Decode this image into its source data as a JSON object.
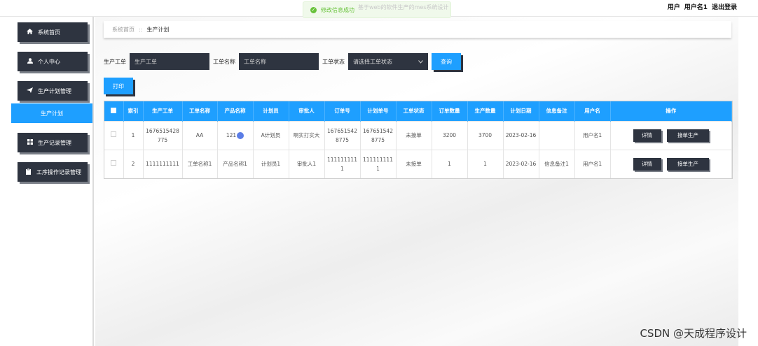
{
  "header": {
    "user_role": "用户",
    "username": "用户名1",
    "logout": "退出登录"
  },
  "toast": {
    "message": "修改信息成功",
    "ghost_title": "基于web的软件生产的mes系统设计"
  },
  "sidebar": {
    "items": [
      {
        "label": "系统首页",
        "icon": "home-icon"
      },
      {
        "label": "个人中心",
        "icon": "user-icon"
      },
      {
        "label": "生产计划管理",
        "icon": "send-icon"
      },
      {
        "label": "生产记录管理",
        "icon": "grid-icon"
      },
      {
        "label": "工序操作记录管理",
        "icon": "clipboard-icon"
      }
    ],
    "active_sub": "生产计划"
  },
  "breadcrumb": {
    "home": "系统首页",
    "separator": "::",
    "current": "生产计划"
  },
  "search": {
    "field1_label": "生产工单",
    "field1_placeholder": "生产工单",
    "field2_label": "工单名称",
    "field2_placeholder": "工单名称",
    "field3_label": "工单状态",
    "field3_placeholder": "请选择工单状态",
    "query_button": "查询"
  },
  "toolbar": {
    "print_button": "打印"
  },
  "table": {
    "headers": [
      "",
      "索引",
      "生产工单",
      "工单名称",
      "产品名称",
      "计划员",
      "审批人",
      "订单号",
      "计划单号",
      "工单状态",
      "订单数量",
      "生产数量",
      "计划日期",
      "信息备注",
      "用户名",
      "操作"
    ],
    "rows": [
      {
        "index": "1",
        "order": "1676515428775",
        "name": "AA",
        "product": "121",
        "planner": "A计划员",
        "approver": "啊实打实大",
        "order_no": "1676515428775",
        "plan_no": "1676515428775",
        "status": "未接单",
        "order_qty": "3200",
        "prod_qty": "3700",
        "date": "2023-02-16",
        "remark": "",
        "user": "用户名1"
      },
      {
        "index": "2",
        "order": "1111111111",
        "name": "工单名称1",
        "product": "产品名称1",
        "planner": "计划员1",
        "approver": "审批人1",
        "order_no": "1111111111",
        "plan_no": "1111111111",
        "status": "未接单",
        "order_qty": "1",
        "prod_qty": "1",
        "date": "2023-02-16",
        "remark": "信息备注1",
        "user": "用户名1"
      }
    ],
    "detail_button": "详情",
    "accept_button": "接单生产"
  },
  "watermark": "CSDN @天成程序设计",
  "colors": {
    "primary": "#1e9fff",
    "dark": "#2e3440",
    "success": "#67c23a"
  }
}
